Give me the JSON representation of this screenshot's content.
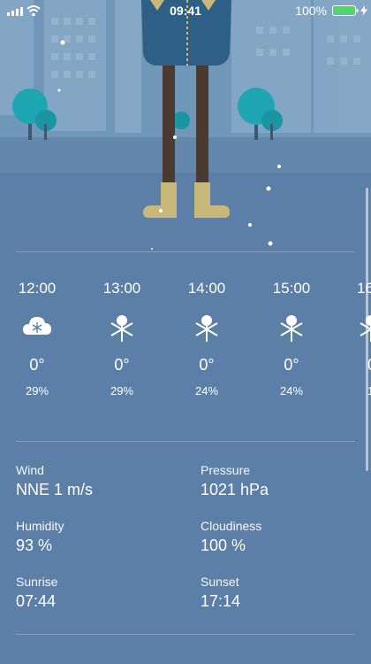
{
  "status_bar": {
    "time": "09:41",
    "battery": "100%"
  },
  "hourly": [
    {
      "time": "12:00",
      "icon": "cloud-snow-icon",
      "temp": "0°",
      "precip": "29%"
    },
    {
      "time": "13:00",
      "icon": "snowflake-icon",
      "temp": "0°",
      "precip": "29%"
    },
    {
      "time": "14:00",
      "icon": "snowflake-icon",
      "temp": "0°",
      "precip": "24%"
    },
    {
      "time": "15:00",
      "icon": "snowflake-icon",
      "temp": "0°",
      "precip": "24%"
    },
    {
      "time": "16",
      "icon": "snowflake-icon",
      "temp": "0",
      "precip": "1"
    }
  ],
  "details": {
    "wind": {
      "label": "Wind",
      "value": "NNE 1 m/s"
    },
    "pressure": {
      "label": "Pressure",
      "value": "1021 hPa"
    },
    "humidity": {
      "label": "Humidity",
      "value": "93 %"
    },
    "cloudiness": {
      "label": "Cloudiness",
      "value": "100 %"
    },
    "sunrise": {
      "label": "Sunrise",
      "value": "07:44"
    },
    "sunset": {
      "label": "Sunset",
      "value": "17:14"
    }
  },
  "colors": {
    "background": "#5b7fa6",
    "sky": "#7096b8",
    "tree": "#1fa6b3",
    "coat": "#2e5f86",
    "boots": "#c8b97a",
    "battery": "#4cd964"
  }
}
